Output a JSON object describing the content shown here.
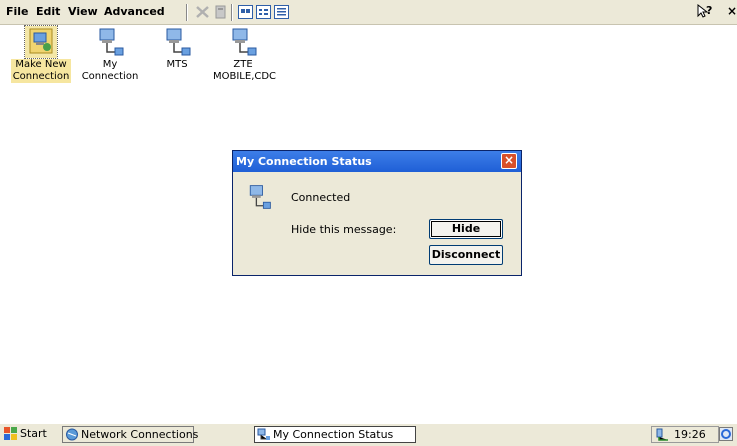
{
  "menubar": {
    "items": [
      {
        "label": "File"
      },
      {
        "label": "Edit"
      },
      {
        "label": "View"
      },
      {
        "label": "Advanced"
      }
    ],
    "help_label": "?",
    "close_label": "×"
  },
  "desktop": {
    "icons": [
      {
        "label": "Make New\nConnection",
        "icon": "make-new-connection-icon",
        "selected": true
      },
      {
        "label": "My\nConnection",
        "icon": "network-connection-icon"
      },
      {
        "label": "MTS",
        "icon": "network-connection-icon"
      },
      {
        "label": "ZTE\nMOBILE,CDC",
        "icon": "network-connection-icon"
      }
    ]
  },
  "dialog": {
    "title": "My Connection Status",
    "status": "Connected",
    "hide_prompt": "Hide this message:",
    "hide_button": "Hide",
    "disconnect_button": "Disconnect"
  },
  "taskbar": {
    "start_label": "Start",
    "tasks": [
      {
        "label": "Network Connections"
      },
      {
        "label": "My Connection Status",
        "active": true
      }
    ],
    "clock": "19:26"
  },
  "colors": {
    "titlebar": "#1f5fd6",
    "close_button": "#d8502a",
    "chrome": "#ece9d8"
  }
}
